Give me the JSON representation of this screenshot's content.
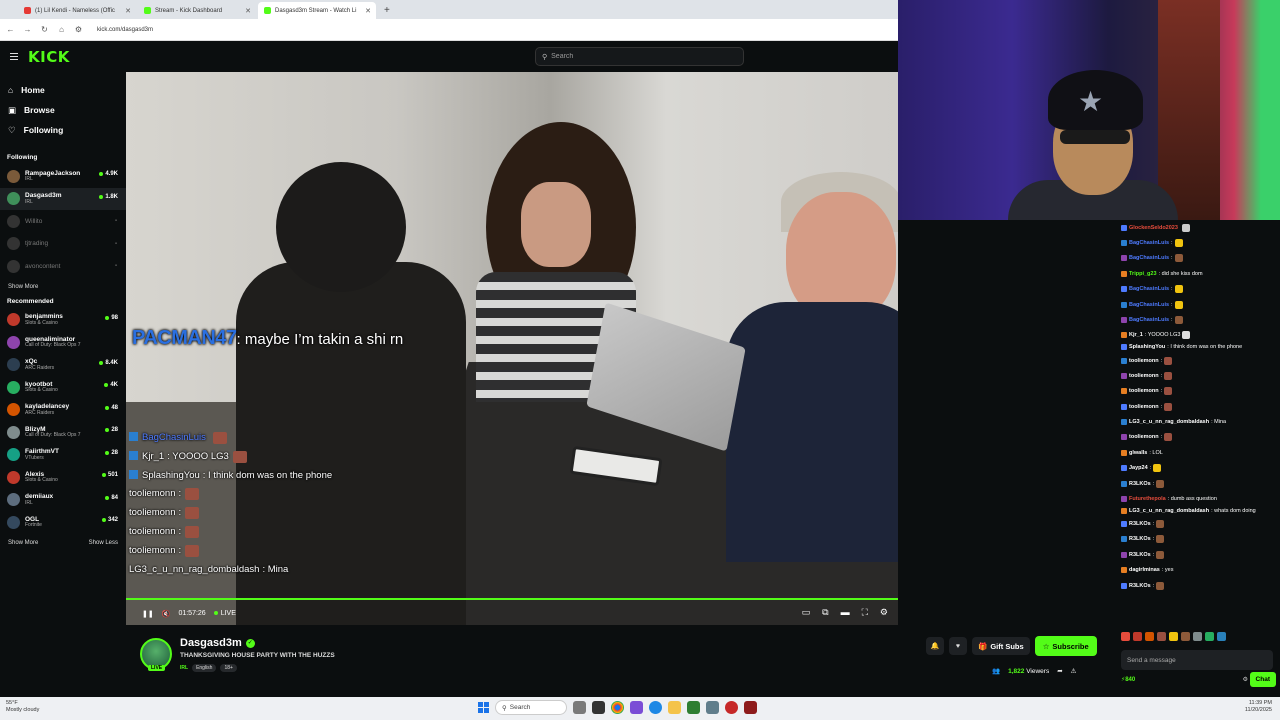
{
  "browser": {
    "tabs": [
      {
        "title": "(1) Lil Kendi - Nameless (Offic",
        "color": "#e53935",
        "active": false
      },
      {
        "title": "Stream - Kick Dashboard",
        "color": "#53fc18",
        "active": false
      },
      {
        "title": "Dasgasd3m Stream - Watch Li",
        "color": "#53fc18",
        "active": true
      }
    ],
    "new_tab": "+",
    "url": "kick.com/dasgasd3m"
  },
  "header": {
    "logo": "KICK",
    "search_placeholder": "Search"
  },
  "sidebar": {
    "nav": [
      {
        "label": "Home",
        "icon": "home-icon"
      },
      {
        "label": "Browse",
        "icon": "browse-icon"
      },
      {
        "label": "Following",
        "icon": "heart-icon"
      }
    ],
    "following_title": "Following",
    "following": [
      {
        "name": "RampageJackson",
        "category": "IRL",
        "viewers": "4.9K",
        "live": true,
        "color": "#7a5a3a"
      },
      {
        "name": "Dasgasd3m",
        "category": "IRL",
        "viewers": "1.8K",
        "live": true,
        "color": "#3f8f5a",
        "selected": true
      },
      {
        "name": "Willito",
        "category": "",
        "viewers": "",
        "live": false,
        "color": "#333"
      },
      {
        "name": "tjtrading",
        "category": "",
        "viewers": "",
        "live": false,
        "color": "#333"
      },
      {
        "name": "avoncontent",
        "category": "",
        "viewers": "",
        "live": false,
        "color": "#333"
      }
    ],
    "show_more": "Show More",
    "recommended_title": "Recommended",
    "recommended": [
      {
        "name": "benjammins",
        "category": "Slots & Casino",
        "viewers": "98",
        "color": "#c0392b"
      },
      {
        "name": "queenaliminator",
        "category": "Call of Duty: Black Ops 7",
        "viewers": "",
        "color": "#8e44ad"
      },
      {
        "name": "xQc",
        "category": "ARC Raiders",
        "viewers": "8.4K",
        "color": "#2c3e50"
      },
      {
        "name": "kyootbot",
        "category": "Slots & Casino",
        "viewers": "4K",
        "color": "#27ae60"
      },
      {
        "name": "kayladelancey",
        "category": "ARC Raiders",
        "viewers": "48",
        "color": "#d35400"
      },
      {
        "name": "BlizyM",
        "category": "Call of Duty: Black Ops 7",
        "viewers": "28",
        "color": "#7f8c8d"
      },
      {
        "name": "FaiirthmVT",
        "category": "VTubers",
        "viewers": "28",
        "color": "#16a085"
      },
      {
        "name": "Alexis",
        "category": "Slots & Casino",
        "viewers": "501",
        "color": "#c0392b"
      },
      {
        "name": "demiiaux",
        "category": "IRL",
        "viewers": "84",
        "color": "#5d6d7e"
      },
      {
        "name": "OGL",
        "category": "Fortnite",
        "viewers": "342",
        "color": "#34495e"
      }
    ],
    "show_more_2": "Show More",
    "show_less": "Show Less"
  },
  "video": {
    "caption_user": "PACMAN47",
    "caption_text": ": maybe I’m takin a shi rn",
    "overlay_chat": [
      {
        "user": "BagChasinLuis",
        "text": "",
        "emote": true
      },
      {
        "user": "Kjr_1",
        "text": ": YOOOO LG3",
        "emote": true
      },
      {
        "user": "SplashingYou",
        "text": ": I think dom was on the phone",
        "emote": false
      },
      {
        "user": "tooliemonn",
        "text": ":",
        "emote": true
      },
      {
        "user": "tooliemonn",
        "text": ":",
        "emote": true
      },
      {
        "user": "tooliemonn",
        "text": ":",
        "emote": true
      },
      {
        "user": "tooliemonn",
        "text": ":",
        "emote": true
      },
      {
        "user": "LG3_c_u_nn_rag_dombaldash",
        "text": ": Mina",
        "emote": false
      }
    ],
    "elapsed": "01:57:26",
    "live_label": "LIVE",
    "progress": 1.0
  },
  "channel": {
    "name": "Dasgasd3m",
    "title": "THANKSGIVING HOUSE PARTY WITH THE HUZZS",
    "category": "IRL",
    "tags": [
      "English",
      "18+"
    ],
    "live_badge": "LIVE",
    "gift_label": "Gift Subs",
    "subscribe_label": "Subscribe",
    "viewer_count": "1,822",
    "viewers_label": "Viewers"
  },
  "chat": {
    "messages": [
      {
        "user": "GlockenSeldo2023",
        "text": "",
        "color": "#e74c3c",
        "emote": "#ccc"
      },
      {
        "user": "BagChasinLuis",
        "text": ":",
        "color": "#4e7bff",
        "emote": "#f1c40f"
      },
      {
        "user": "BagChasinLuis",
        "text": ":",
        "color": "#4e7bff",
        "emote": "#8d5a3a"
      },
      {
        "user": "Trippi_g23",
        "text": ": did she kiss dom",
        "color": "#53fc18",
        "emote": ""
      },
      {
        "user": "BagChasinLuis",
        "text": ":",
        "color": "#4e7bff",
        "emote": "#f1c40f"
      },
      {
        "user": "BagChasinLuis",
        "text": ":",
        "color": "#4e7bff",
        "emote": "#f1c40f"
      },
      {
        "user": "BagChasinLuis",
        "text": ":",
        "color": "#4e7bff",
        "emote": "#8d5a3a"
      },
      {
        "user": "Kjr_1",
        "text": ": YOOOO LG3",
        "color": "#fff",
        "emote": "#ddd"
      },
      {
        "user": "SplashingYou",
        "text": ": I think dom was on the phone",
        "color": "#fff",
        "emote": "",
        "multi": true
      },
      {
        "user": "tooliemonn",
        "text": ":",
        "color": "#fff",
        "emote": "#9a5040"
      },
      {
        "user": "tooliemonn",
        "text": ":",
        "color": "#fff",
        "emote": "#9a5040"
      },
      {
        "user": "tooliemonn",
        "text": ":",
        "color": "#fff",
        "emote": "#9a5040"
      },
      {
        "user": "tooliemonn",
        "text": ":",
        "color": "#fff",
        "emote": "#9a5040"
      },
      {
        "user": "LG3_c_u_nn_rag_dombaldash",
        "text": ": Mina",
        "color": "#fff",
        "emote": ""
      },
      {
        "user": "tooliemonn",
        "text": ":",
        "color": "#fff",
        "emote": "#9a5040"
      },
      {
        "user": "glwalls",
        "text": ": LOL",
        "color": "#fff",
        "emote": ""
      },
      {
        "user": "Jayp24",
        "text": ":",
        "color": "#fff",
        "emote": "#f1c40f"
      },
      {
        "user": "R3LKOs",
        "text": ":",
        "color": "#fff",
        "emote": "#8d5a3a"
      },
      {
        "user": "Futurethepola",
        "text": ": dumb ass question",
        "color": "#e74c3c",
        "emote": ""
      },
      {
        "user": "LG3_c_u_nn_rag_dombaldash",
        "text": ": whats dom doing",
        "color": "#fff",
        "emote": "",
        "multi": true
      },
      {
        "user": "R3LKOs",
        "text": ":",
        "color": "#fff",
        "emote": "#8d5a3a"
      },
      {
        "user": "R3LKOs",
        "text": ":",
        "color": "#fff",
        "emote": "#8d5a3a"
      },
      {
        "user": "R3LKOs",
        "text": ":",
        "color": "#fff",
        "emote": "#8d5a3a"
      },
      {
        "user": "dagirlminas",
        "text": ": yes",
        "color": "#fff",
        "emote": ""
      },
      {
        "user": "R3LKOs",
        "text": ":",
        "color": "#fff",
        "emote": "#8d5a3a"
      }
    ],
    "input_placeholder": "Send a message",
    "points": "840",
    "chat_button": "Chat"
  },
  "taskbar": {
    "temp": "55°F",
    "weather": "Mostly cloudy",
    "search": "Search",
    "time": "11:39 PM",
    "date": "11/20/2025"
  }
}
